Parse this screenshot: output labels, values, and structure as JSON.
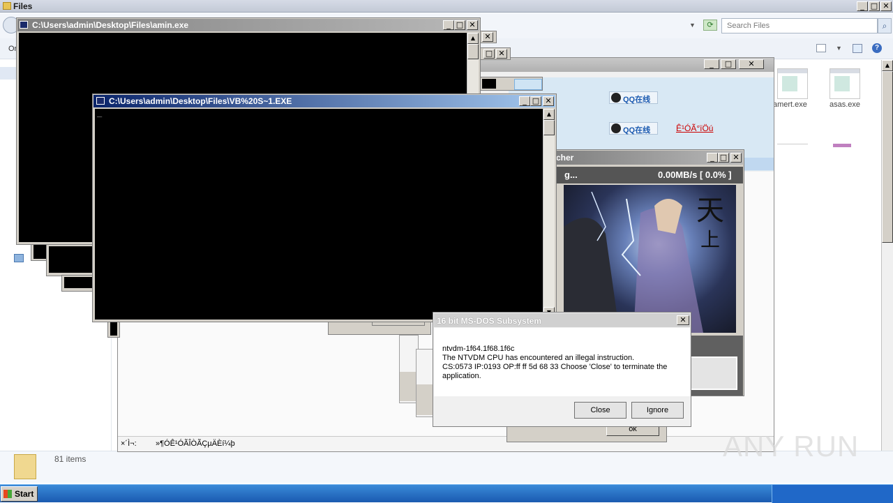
{
  "explorer": {
    "title": "Files",
    "search_placeholder": "Search Files",
    "left_stub": "Or",
    "status_items": "81 items",
    "files": [
      {
        "name": "amert.exe"
      },
      {
        "name": "asas.exe"
      }
    ]
  },
  "console1": {
    "title": "C:\\Users\\admin\\Desktop\\Files\\amin.exe"
  },
  "console2": {
    "title": "C:\\Users\\admin\\Desktop\\Files\\VB%20S~1.EXE",
    "cursor": "_"
  },
  "qq_window": {
    "qq_online_1": "QQ在线",
    "qq_online_2": "QQ在线",
    "garbled_link": "Ê¹ÓÃ°ïÖú",
    "status_left": "×´Ì¬:",
    "status_right": "»¶Ó­Ê¹ÓÃÎÒÃÇµÄÈí¼þ"
  },
  "launcher": {
    "title_partial": "cher",
    "progress_label": "g...",
    "speed": "0.00MB/s [ 0.0% ]",
    "ok_partial": "ok"
  },
  "dialog": {
    "title": "16 bit MS-DOS Subsystem",
    "line1": "ntvdm-1f64.1f68.1f6c",
    "line2": "The NTVDM CPU has encountered an illegal instruction.",
    "line3": "CS:0573 IP:0193 OP:ff ff 5d 68 33 Choose 'Close' to terminate the application.",
    "close_label": "Close",
    "ignore_label": "Ignore"
  },
  "taskbar": {
    "start_label": "Start"
  },
  "watermark": {
    "text": "ANY RUN"
  }
}
